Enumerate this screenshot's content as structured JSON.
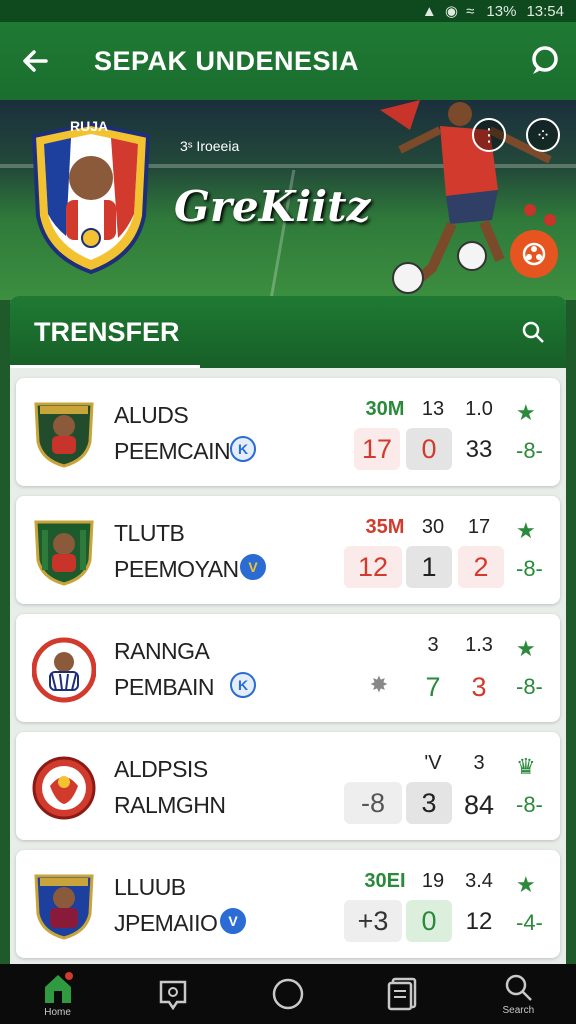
{
  "status": {
    "signal": "▲ ◉ ≈",
    "battery": "13%",
    "time": "13:54"
  },
  "appbar": {
    "title": "SEPAK UNDENESIA",
    "back_icon": "arrow-left-icon",
    "chat_icon": "chat-bubble-icon"
  },
  "hero": {
    "badge_label": "RUJA",
    "small_text": "3ˢ Iroeeia",
    "title": "GreKiitz"
  },
  "panel": {
    "title": "TRENSFER"
  },
  "rows": [
    {
      "line1": "ALUDS",
      "line2": "PEEMCAIN",
      "badge": "K",
      "top1": "30M",
      "top2": "13",
      "top3": "1.0",
      "box1": "17",
      "box2": "0",
      "bot3": "33",
      "trend": "-8-"
    },
    {
      "line1": "TLUTB",
      "line2": "PEEMOYAN",
      "badge": "V",
      "top1": "35M",
      "top2": "30",
      "top3": "17",
      "box1": "12",
      "box2": "1",
      "bot3": "2",
      "trend": "-8-"
    },
    {
      "line1": "RANNGA",
      "line2": "PEMBAIN",
      "badge": "K",
      "top1": "",
      "top2": "3",
      "top3": "1.3",
      "box1": "✸",
      "box2": "7",
      "bot3": "3",
      "trend": "-8-"
    },
    {
      "line1": "ALDPSIS",
      "line2": "RALMGHN",
      "badge": "",
      "top1": "",
      "top2": "'V",
      "top3": "3",
      "box1": "-8",
      "box2": "3",
      "bot3": "84",
      "trend": "-8-"
    },
    {
      "line1": "LLUUB",
      "line2": "JPEMAIIO",
      "badge": "V",
      "top1": "30EI",
      "top2": "19",
      "top3": "3.4",
      "box1": "+3",
      "box2": "0",
      "bot3": "12",
      "trend": "-4-"
    }
  ],
  "nav": [
    {
      "label": "Home",
      "icon": "home-icon"
    },
    {
      "label": "",
      "icon": "news-icon"
    },
    {
      "label": "",
      "icon": "circle-home-icon"
    },
    {
      "label": "",
      "icon": "document-icon"
    },
    {
      "label": "Search",
      "icon": "search-icon"
    }
  ],
  "colors": {
    "green": "#1f7a33",
    "red": "#d13a2c",
    "accent_orange": "#e6541f"
  }
}
